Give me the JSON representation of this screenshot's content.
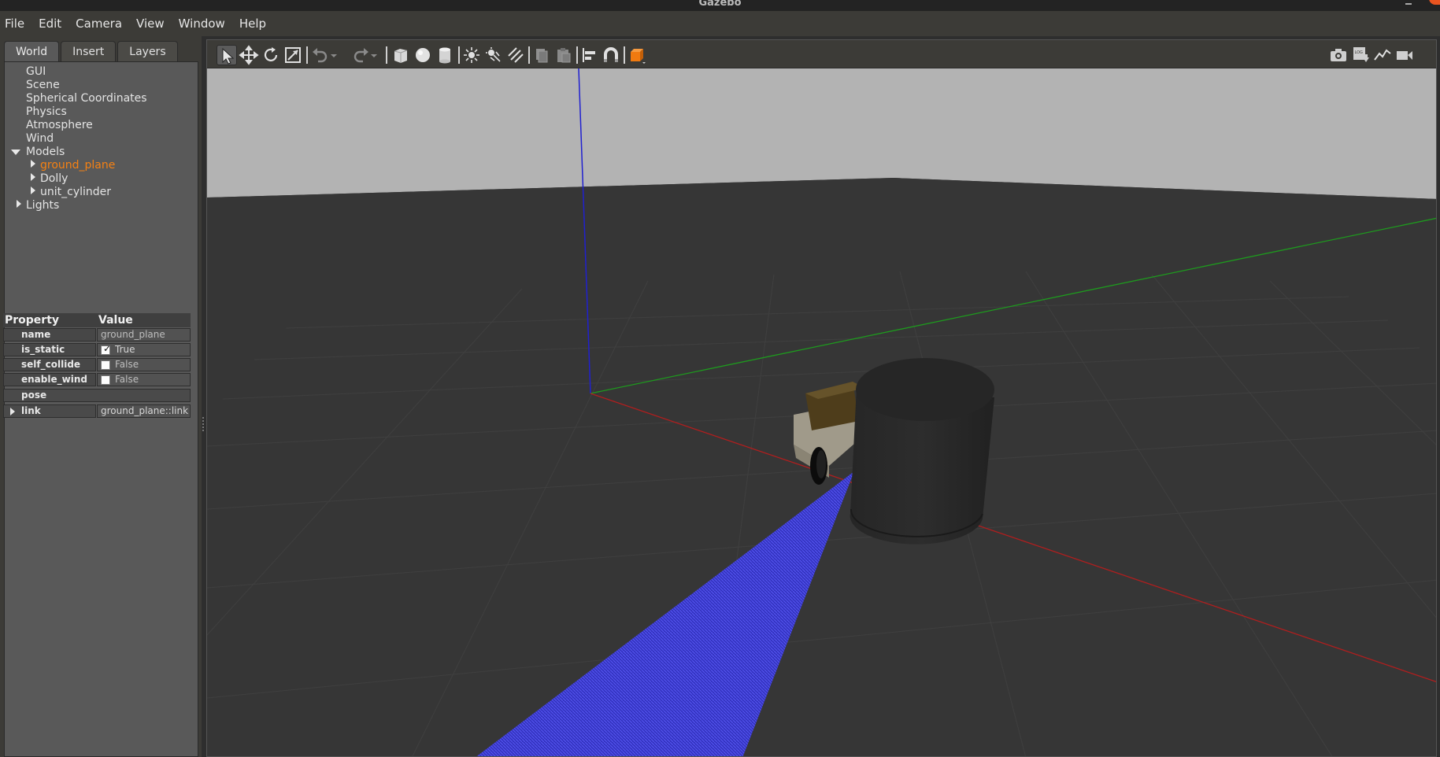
{
  "window": {
    "title": "Gazebo"
  },
  "menu": [
    "File",
    "Edit",
    "Camera",
    "View",
    "Window",
    "Help"
  ],
  "left_panel": {
    "tabs": [
      {
        "label": "World",
        "active": true
      },
      {
        "label": "Insert",
        "active": false
      },
      {
        "label": "Layers",
        "active": false
      }
    ],
    "tree": {
      "gui": "GUI",
      "scene": "Scene",
      "spherical": "Spherical Coordinates",
      "physics": "Physics",
      "atmosphere": "Atmosphere",
      "wind": "Wind",
      "models": "Models",
      "model_items": [
        "ground_plane",
        "Dolly",
        "unit_cylinder"
      ],
      "selected_model": "ground_plane",
      "lights": "Lights"
    },
    "properties": {
      "header_property": "Property",
      "header_value": "Value",
      "rows": [
        {
          "key": "name",
          "value": "ground_plane"
        },
        {
          "key": "is_static",
          "value": "True",
          "checked": true
        },
        {
          "key": "self_collide",
          "value": "False",
          "checked": false
        },
        {
          "key": "enable_wind",
          "value": "False",
          "checked": false
        },
        {
          "key": "pose",
          "value": ""
        },
        {
          "key": "link",
          "value": "ground_plane::link"
        }
      ]
    }
  },
  "toolbar": {
    "tools": [
      "select-mode",
      "translate-mode",
      "rotate-mode",
      "scale-mode",
      "undo",
      "undo-history",
      "redo",
      "redo-history",
      "box",
      "sphere",
      "cylinder",
      "point-light",
      "spot-light",
      "directional-light",
      "copy",
      "paste",
      "align",
      "snap",
      "change-view",
      "screenshot",
      "log-data",
      "plot",
      "video-record"
    ],
    "active_tool": "select-mode"
  },
  "colors": {
    "accent": "#f58113",
    "x_axis": "#b01e1e",
    "y_axis": "#1e9a1e",
    "z_axis": "#2020d0",
    "laser": "#3c3cff",
    "sky": "#b3b3b3",
    "ground": "#363636"
  }
}
